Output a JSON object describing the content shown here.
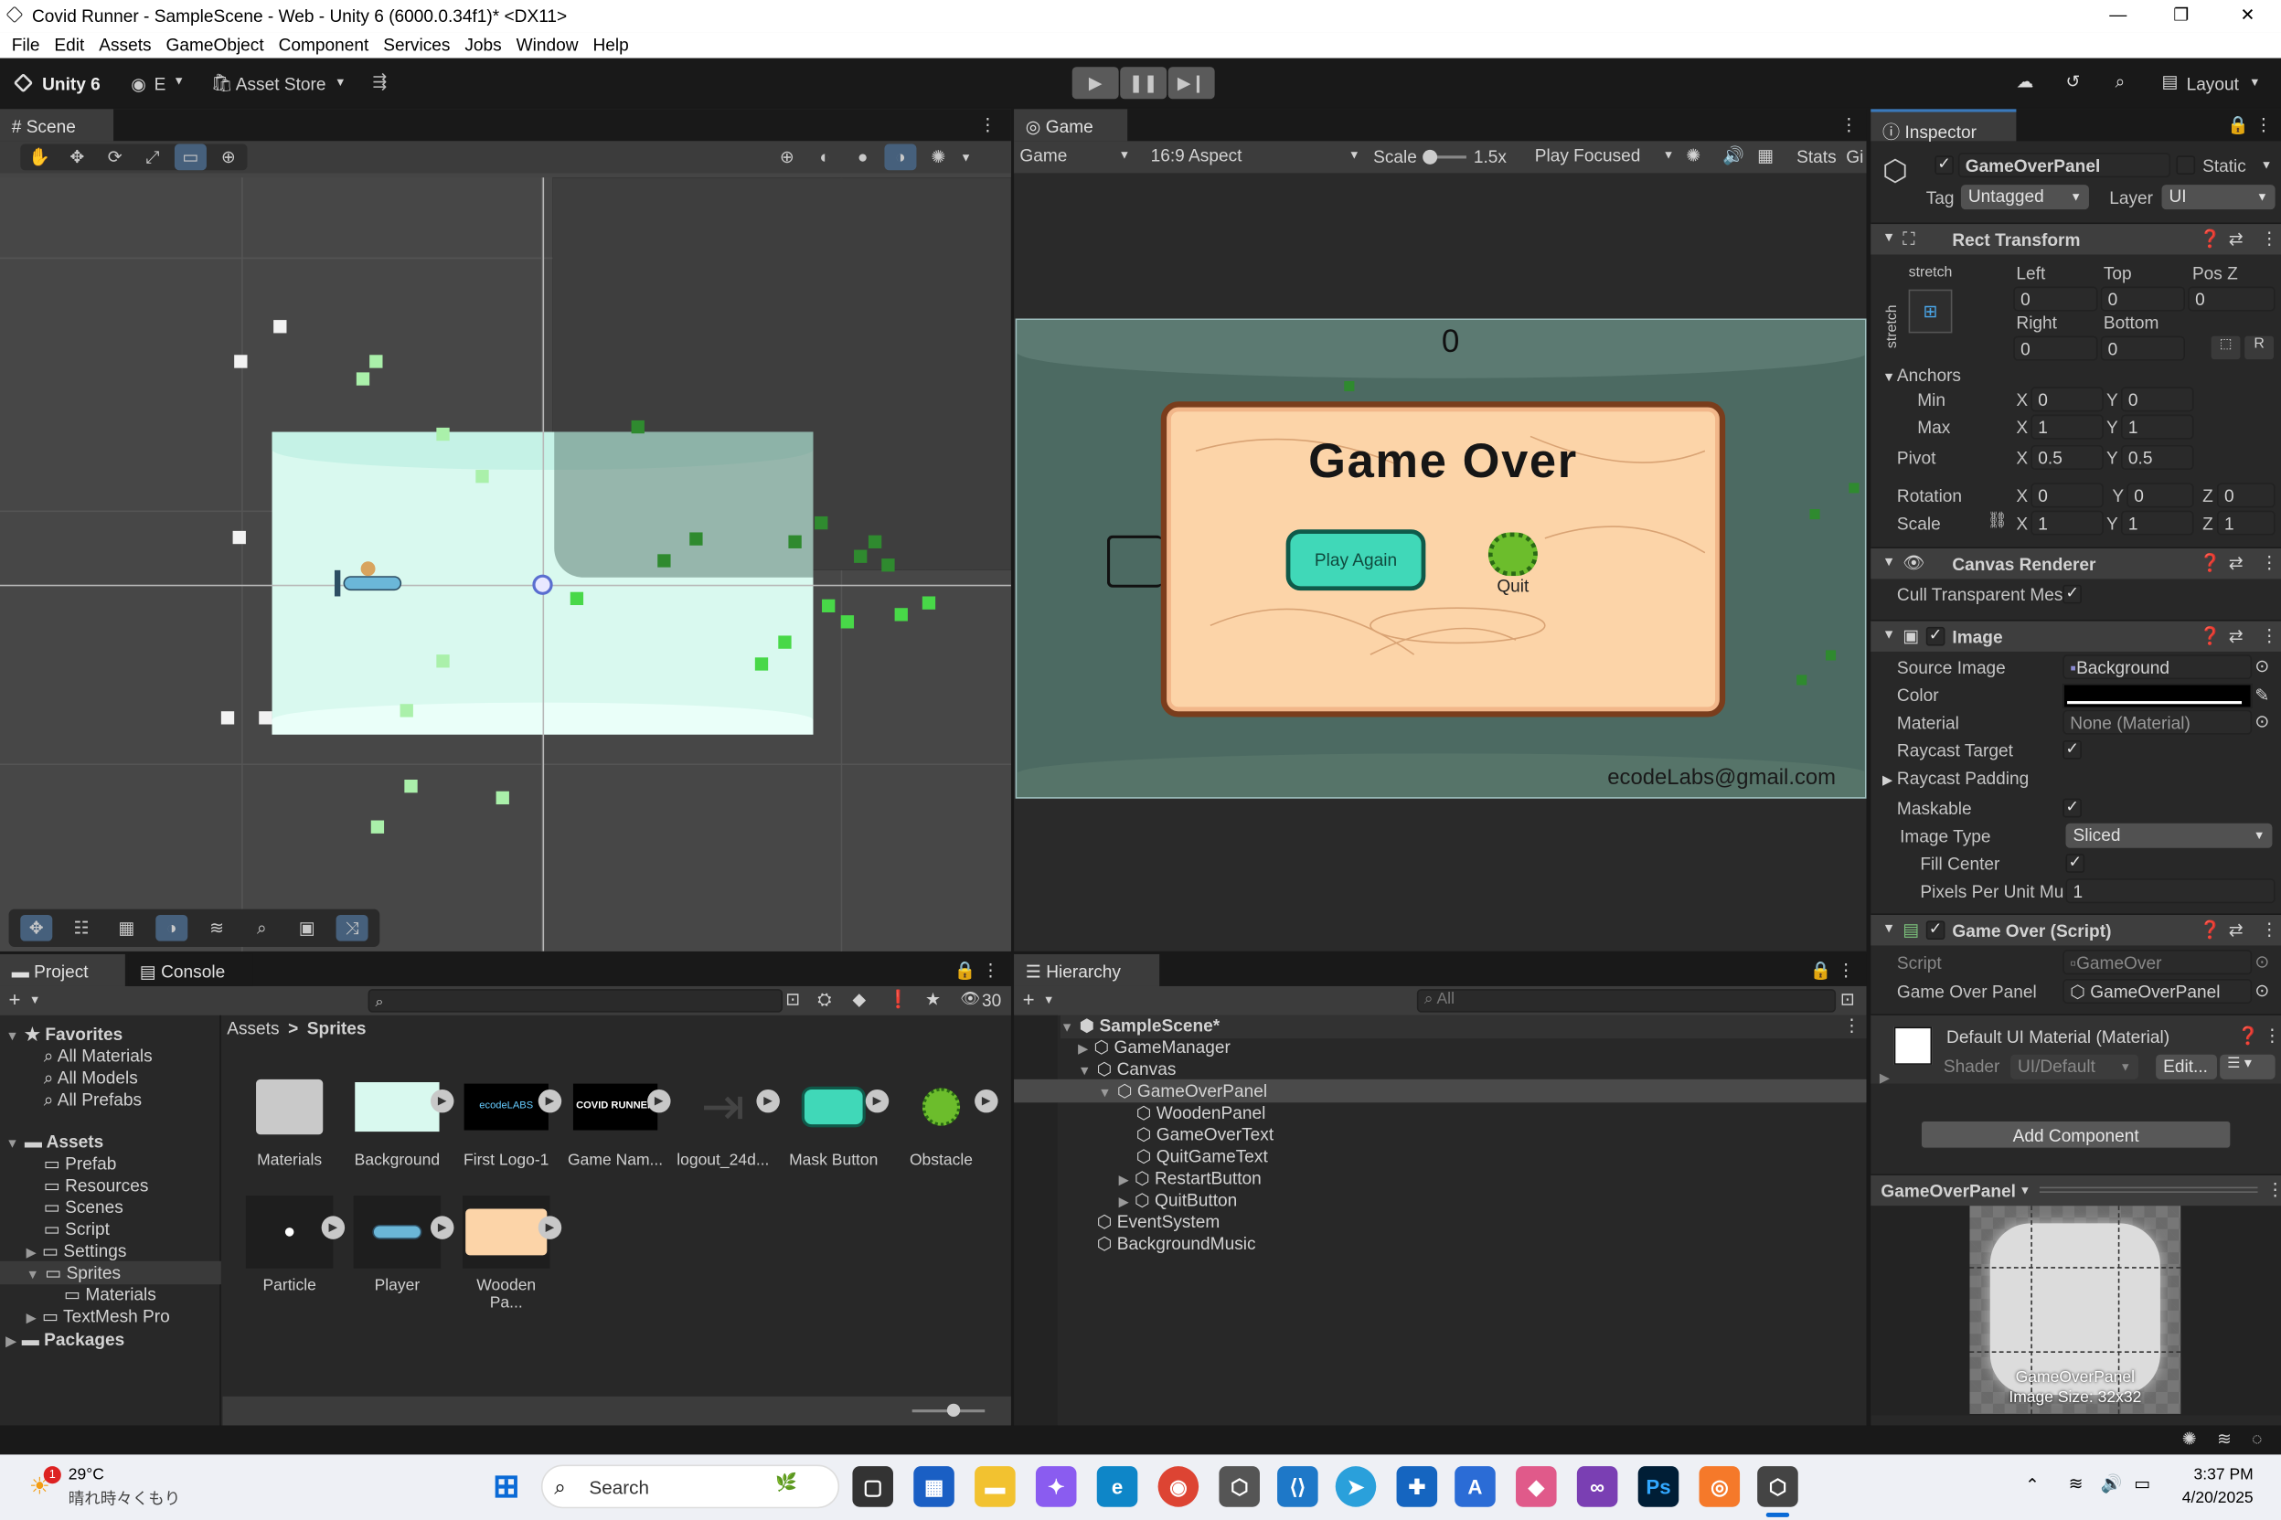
{
  "window": {
    "title": "Covid Runner - SampleScene - Web - Unity 6 (6000.0.34f1)* <DX11>",
    "minimize": "—",
    "maximize": "❐",
    "close": "✕"
  },
  "menu": [
    "File",
    "Edit",
    "Assets",
    "GameObject",
    "Component",
    "Services",
    "Jobs",
    "Window",
    "Help"
  ],
  "toolbar": {
    "brand": "Unity 6",
    "account": "E",
    "asset_store": "Asset Store",
    "layout": "Layout"
  },
  "scene": {
    "tab": "Scene"
  },
  "game": {
    "tab": "Game",
    "display": "Game",
    "aspect": "16:9 Aspect",
    "scale_label": "Scale",
    "scale_value": "1.5x",
    "play_mode": "Play Focused",
    "stats": "Stats",
    "gizmos": "Gi",
    "score": "0",
    "panel_title": "Game Over",
    "play_again": "Play Again",
    "quit": "Quit",
    "credit": "ecodeLabs@gmail.com"
  },
  "inspector": {
    "tab": "Inspector",
    "object_name": "GameOverPanel",
    "static_label": "Static",
    "tag_label": "Tag",
    "tag_value": "Untagged",
    "layer_label": "Layer",
    "layer_value": "UI",
    "rect_transform": {
      "title": "Rect Transform",
      "stretch": "stretch",
      "stretch_v": "stretch",
      "left_label": "Left",
      "top_label": "Top",
      "posz_label": "Pos Z",
      "left": "0",
      "top": "0",
      "posz": "0",
      "right_label": "Right",
      "bottom_label": "Bottom",
      "right": "0",
      "bottom": "0",
      "r_btn": "R",
      "anchors": "Anchors",
      "min": "Min",
      "max": "Max",
      "pivot": "Pivot",
      "x": "X",
      "y": "Y",
      "z": "Z",
      "min_x": "0",
      "min_y": "0",
      "max_x": "1",
      "max_y": "1",
      "pivot_x": "0.5",
      "pivot_y": "0.5",
      "rotation": "Rotation",
      "rot_x": "0",
      "rot_y": "0",
      "rot_z": "0",
      "scale": "Scale",
      "scale_x": "1",
      "scale_y": "1",
      "scale_z": "1"
    },
    "canvas_renderer": {
      "title": "Canvas Renderer",
      "cull": "Cull Transparent Mes"
    },
    "image": {
      "title": "Image",
      "source_label": "Source Image",
      "source_value": "Background",
      "color_label": "Color",
      "material_label": "Material",
      "material_value": "None (Material)",
      "raycast_target": "Raycast Target",
      "raycast_padding": "Raycast Padding",
      "maskable": "Maskable",
      "image_type_label": "Image Type",
      "image_type": "Sliced",
      "fill_center": "Fill Center",
      "ppu_label": "Pixels Per Unit Mu",
      "ppu_value": "1"
    },
    "script": {
      "title": "Game Over (Script)",
      "script_label": "Script",
      "script_value": "GameOver",
      "panel_label": "Game Over Panel",
      "panel_value": "GameOverPanel"
    },
    "material": {
      "title": "Default UI Material (Material)",
      "shader_label": "Shader",
      "shader_value": "UI/Default",
      "edit": "Edit..."
    },
    "add_component": "Add Component",
    "preview": {
      "name": "GameOverPanel",
      "caption1": "GameOverPanel",
      "caption2": "Image Size: 32x32"
    }
  },
  "project": {
    "tab": "Project",
    "console_tab": "Console",
    "count": "30",
    "favorites": "Favorites",
    "fav_items": [
      "All Materials",
      "All Models",
      "All Prefabs"
    ],
    "assets": "Assets",
    "folders": [
      "Prefab",
      "Resources",
      "Scenes",
      "Script",
      "Settings",
      "Sprites",
      "Materials",
      "TextMesh Pro"
    ],
    "packages": "Packages",
    "breadcrumb_root": "Assets",
    "breadcrumb_sep": ">",
    "breadcrumb_current": "Sprites",
    "items": [
      "Materials",
      "Background",
      "First Logo-1",
      "Game Nam...",
      "logout_24d...",
      "Mask Button",
      "Obstacle",
      "Particle",
      "Player",
      "Wooden Pa..."
    ],
    "logo_text": "ecodeLABS",
    "covid_text": "COVID RUNNER"
  },
  "hierarchy": {
    "tab": "Hierarchy",
    "search_placeholder": "All",
    "scene": "SampleScene*",
    "items": [
      "GameManager",
      "Canvas",
      "GameOverPanel",
      "WoodenPanel",
      "GameOverText",
      "QuitGameText",
      "RestartButton",
      "QuitButton",
      "EventSystem",
      "BackgroundMusic"
    ]
  },
  "taskbar": {
    "temp": "29°C",
    "weather": "晴れ時々くもり",
    "badge": "1",
    "search": "Search",
    "time": "3:37 PM",
    "date": "4/20/2025"
  },
  "colors": {
    "accent": "#3a79bb",
    "panel": "#282828",
    "wood": "#fcd4a8",
    "mask": "#40d8b8",
    "covid_green": "#6cbd2c"
  }
}
